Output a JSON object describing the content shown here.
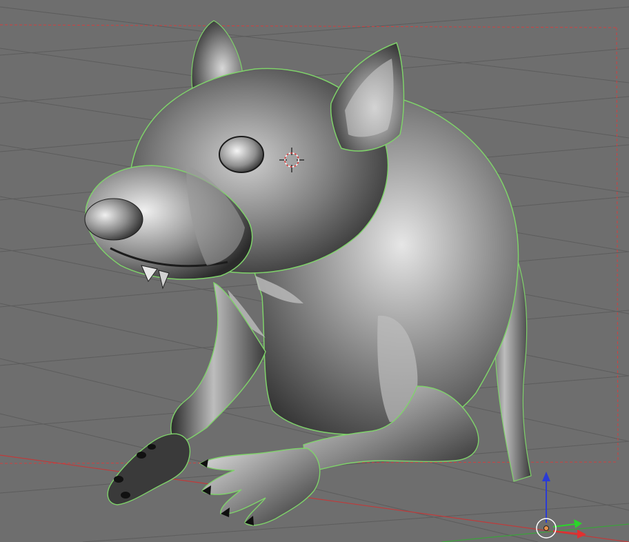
{
  "viewport": {
    "background_color": "#6e6e6e",
    "grid_color": "#5a5a5a",
    "x_axis_color": "#c03a3a",
    "y_axis_color": "#3aa33a",
    "camera_border_color": "#d04040",
    "selection_outline_color": "#7fd36a"
  },
  "scene": {
    "object_kind": "rat-sculpt",
    "mesh_colors": {
      "dark": "#1f1f1f",
      "mid": "#5a5a5a",
      "light": "#d9d9d9",
      "highlight": "#f2f2f2"
    }
  },
  "cursor3d": {
    "icon": "crosshair-3d-cursor-icon",
    "ring_color_a": "#e23b3b",
    "ring_color_b": "#ffffff"
  },
  "gizmo": {
    "icon": "transform-manipulator-icon",
    "z_color": "#2a3bd6",
    "y_color": "#2ad62a",
    "x_color": "#e23030",
    "origin_color": "#e8904a"
  }
}
